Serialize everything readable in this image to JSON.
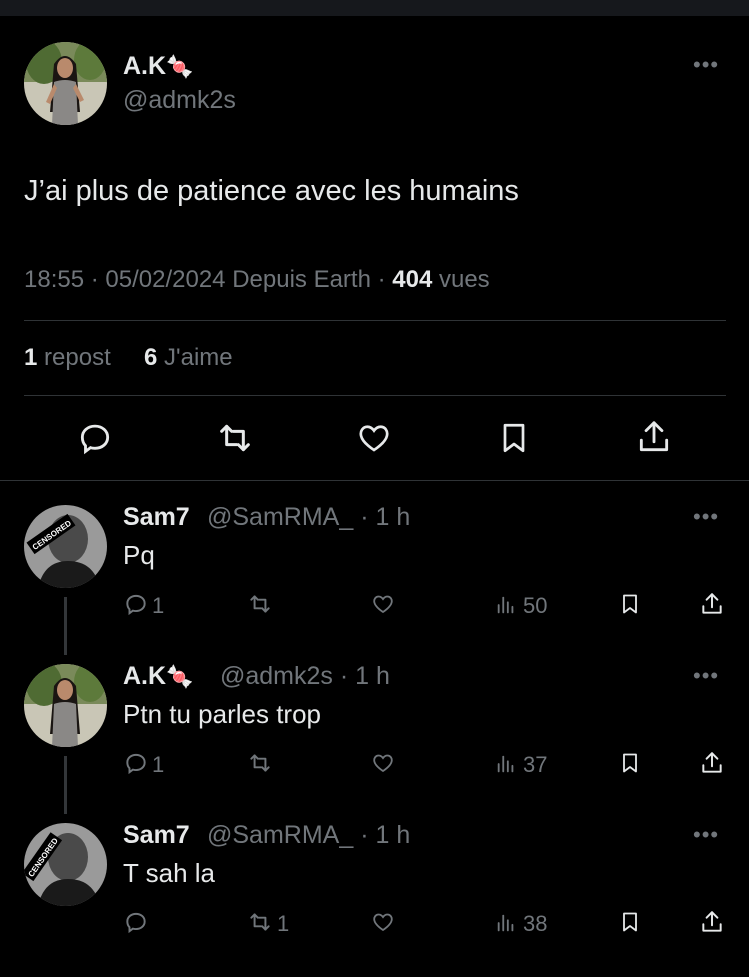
{
  "main_post": {
    "author_name": "A.K",
    "author_emoji": "🍬",
    "handle": "@admk2s",
    "text": "J’ai plus de patience avec les humains",
    "time": "18:55",
    "date": "05/02/2024",
    "location": "Depuis Earth",
    "views_count": "404",
    "views_label": "vues",
    "reposts_count": "1",
    "reposts_label": "repost",
    "likes_count": "6",
    "likes_label": "J'aime"
  },
  "replies": [
    {
      "author_name": "Sam7",
      "handle": "@SamRMA_",
      "time_ago": "1 h",
      "text": "Pq",
      "reply_count": "1",
      "repost_count": "",
      "views": "50",
      "avatar_label": "CENSORED"
    },
    {
      "author_name": "A.K",
      "author_emoji": "🍬",
      "handle": "@admk2s",
      "time_ago": "1 h",
      "text": "Ptn tu parles trop",
      "reply_count": "1",
      "repost_count": "",
      "views": "37"
    },
    {
      "author_name": "Sam7",
      "handle": "@SamRMA_",
      "time_ago": "1 h",
      "text": "T sah la",
      "reply_count": "",
      "repost_count": "1",
      "views": "38",
      "avatar_label": "CENSORED"
    }
  ],
  "icons": {
    "reply": "reply-icon",
    "repost": "repost-icon",
    "like": "heart-icon",
    "views": "views-icon",
    "bookmark": "bookmark-icon",
    "share": "share-icon",
    "more": "more-icon"
  },
  "colors": {
    "background": "#000000",
    "text": "#e7e9ea",
    "secondary": "#71767b",
    "divider": "#2f3336"
  }
}
